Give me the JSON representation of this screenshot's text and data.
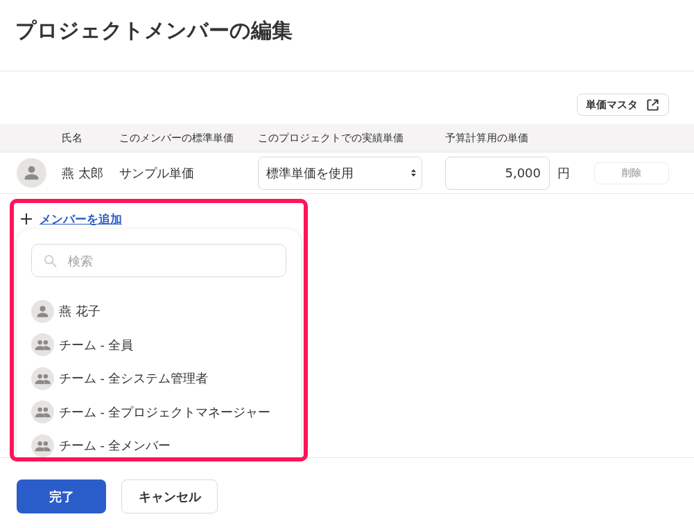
{
  "page": {
    "title": "プロジェクトメンバーの編集"
  },
  "toolbar": {
    "unit_price_master_button": "単価マスタ"
  },
  "table": {
    "columns": [
      "氏名",
      "このメンバーの標準単価",
      "このプロジェクトでの実績単価",
      "予算計算用の単価"
    ],
    "rows": [
      {
        "name": "燕 太郎",
        "standard_price": "サンプル単価",
        "actual_price": {
          "value": "標準単価を使用"
        },
        "budget_price": {
          "value": "5,000",
          "unit": "円"
        },
        "delete_button": {
          "label": "削除",
          "disabled": true
        }
      }
    ]
  },
  "add_member": {
    "link": "メンバーを追加",
    "highlighted": true,
    "dropdown": {
      "search": {
        "placeholder": "検索"
      },
      "items": [
        {
          "kind": "person",
          "label": "燕 花子"
        },
        {
          "kind": "team",
          "label": "チーム - 全員"
        },
        {
          "kind": "team",
          "label": "チーム - 全システム管理者"
        },
        {
          "kind": "team",
          "label": "チーム - 全プロジェクトマネージャー"
        },
        {
          "kind": "team",
          "label": "チーム - 全メンバー"
        }
      ]
    }
  },
  "footer": {
    "buttons": [
      {
        "kind": "primary",
        "label": "完了"
      },
      {
        "kind": "secondary",
        "label": "キャンセル"
      }
    ]
  }
}
